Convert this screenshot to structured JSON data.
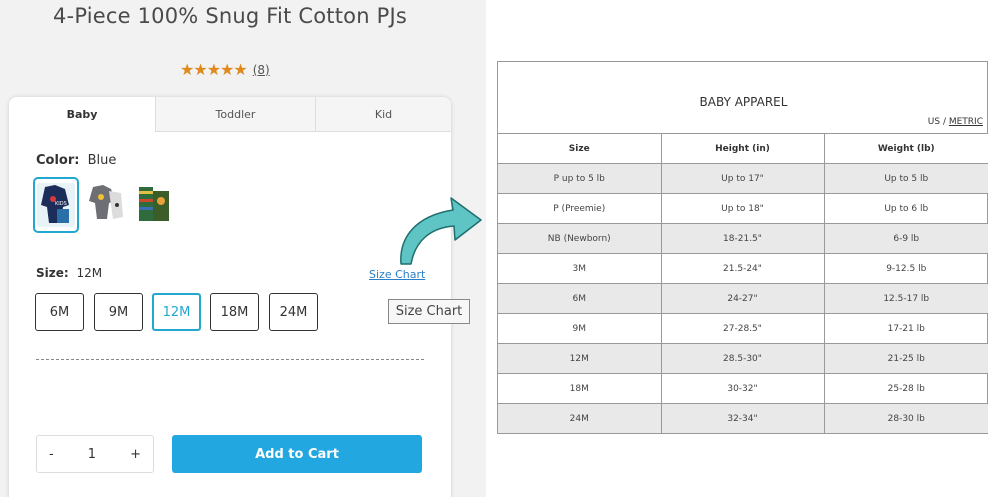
{
  "product": {
    "title": "4-Piece 100% Snug Fit Cotton PJs",
    "stars": "★★★★★",
    "review_count": "(8)"
  },
  "tabs": [
    {
      "label": "Baby",
      "active": true
    },
    {
      "label": "Toddler",
      "active": false
    },
    {
      "label": "Kid",
      "active": false
    }
  ],
  "color": {
    "label": "Color:",
    "value": "Blue"
  },
  "size": {
    "label": "Size:",
    "value": "12M",
    "chart_link": "Size Chart",
    "options": [
      "6M",
      "9M",
      "12M",
      "18M",
      "24M"
    ],
    "selected": "12M"
  },
  "quantity": {
    "minus": "-",
    "value": "1",
    "plus": "+"
  },
  "cart": {
    "add_label": "Add to Cart"
  },
  "tooltip": "Size Chart",
  "size_chart": {
    "title": "BABY APPAREL",
    "units_us": "US",
    "units_sep": " / ",
    "units_metric": "METRIC",
    "headers": [
      "Size",
      "Height (in)",
      "Weight (lb)"
    ],
    "rows": [
      [
        "P up to 5 lb",
        "Up to 17\"",
        "Up to 5 lb"
      ],
      [
        "P (Preemie)",
        "Up to 18\"",
        "Up to 6 lb"
      ],
      [
        "NB (Newborn)",
        "18-21.5\"",
        "6-9 lb"
      ],
      [
        "3M",
        "21.5-24\"",
        "9-12.5 lb"
      ],
      [
        "6M",
        "24-27\"",
        "12.5-17 lb"
      ],
      [
        "9M",
        "27-28.5\"",
        "17-21 lb"
      ],
      [
        "12M",
        "28.5-30\"",
        "21-25 lb"
      ],
      [
        "18M",
        "30-32\"",
        "25-28 lb"
      ],
      [
        "24M",
        "32-34\"",
        "28-30 lb"
      ]
    ]
  },
  "colors": {
    "accent": "#22a7cf",
    "cart_button": "#22a7e0",
    "arrow": "#5ec4c4",
    "star": "#e08a1e"
  }
}
